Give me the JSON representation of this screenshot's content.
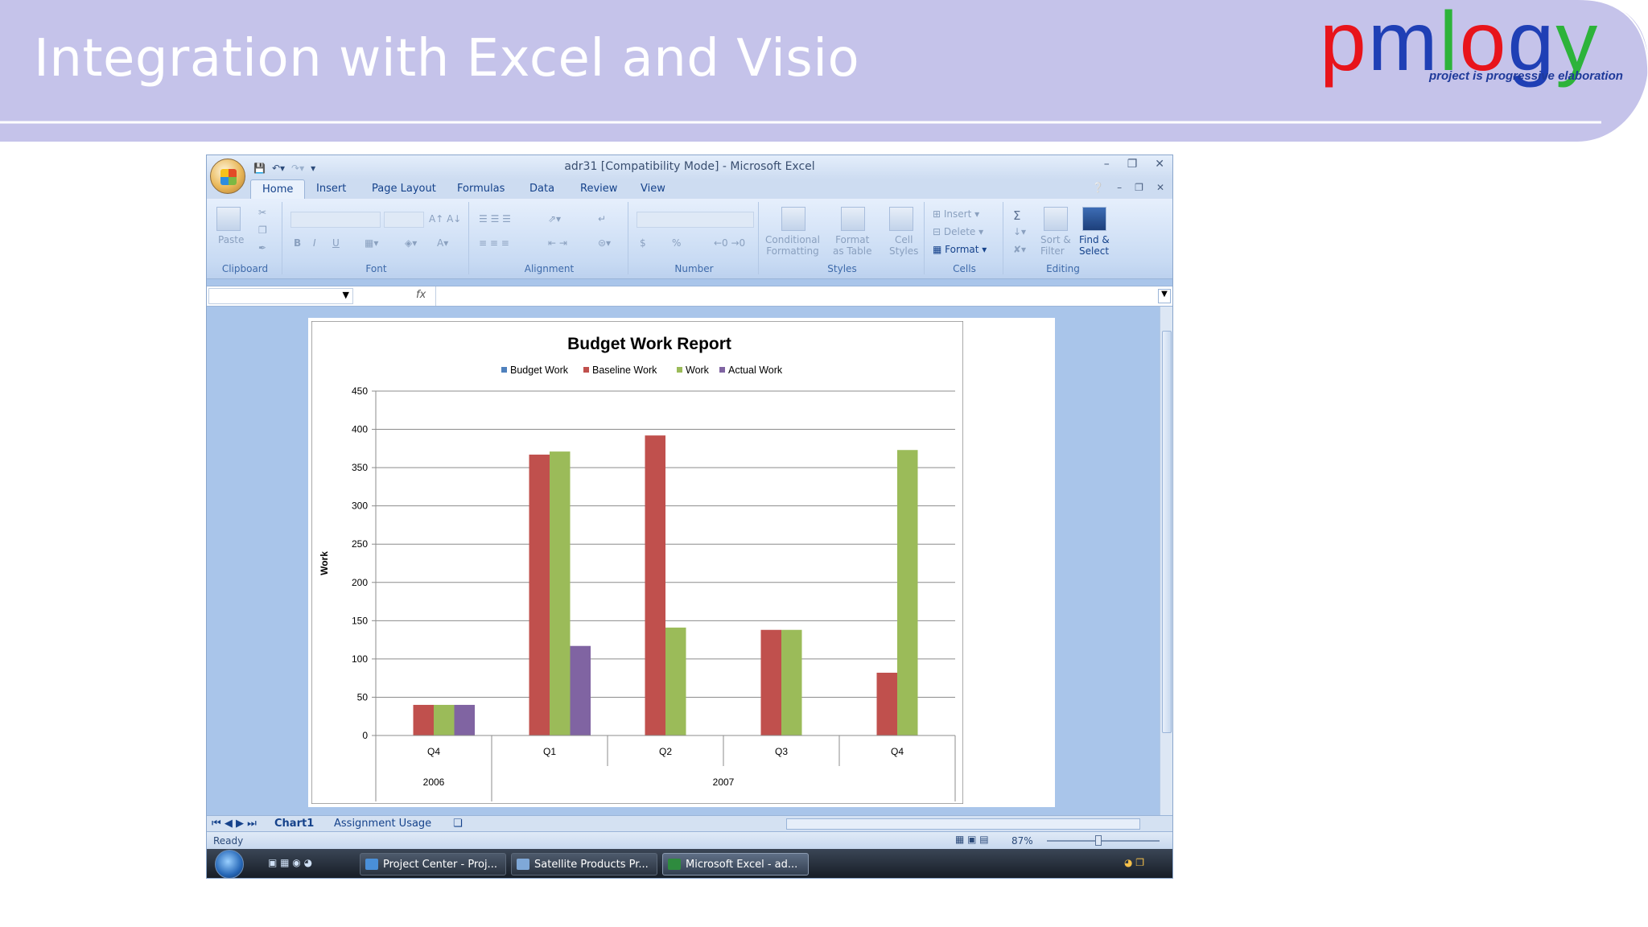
{
  "slide": {
    "title": "Integration with Excel and Visio",
    "logo": {
      "letters": [
        "p",
        "m",
        "l",
        "o",
        "g",
        "y"
      ],
      "colors": [
        "#e8141b",
        "#1f3fb5",
        "#2db33a",
        "#e8141b",
        "#1f3fb5",
        "#2db33a"
      ],
      "tagline": "project is progressive elaboration"
    }
  },
  "excel": {
    "title": "adr31  [Compatibility Mode] - Microsoft Excel",
    "tabs": [
      "Home",
      "Insert",
      "Page Layout",
      "Formulas",
      "Data",
      "Review",
      "View"
    ],
    "active_tab": "Home",
    "ribbon": {
      "clipboard": {
        "label": "Clipboard",
        "paste": "Paste"
      },
      "font": {
        "label": "Font",
        "bold": "B",
        "italic": "I",
        "underline": "U"
      },
      "alignment": {
        "label": "Alignment"
      },
      "number": {
        "label": "Number",
        "currency": "$",
        "percent": "%"
      },
      "styles": {
        "label": "Styles",
        "conditional": "Conditional\nFormatting",
        "format_table": "Format\nas Table",
        "cell_styles": "Cell\nStyles"
      },
      "cells": {
        "label": "Cells",
        "insert": "Insert",
        "delete": "Delete",
        "format": "Format"
      },
      "editing": {
        "label": "Editing",
        "sigma": "Σ",
        "sort": "Sort &\nFilter",
        "find": "Find &\nSelect"
      }
    },
    "formula_bar": {
      "fx": "fx"
    },
    "sheets": [
      "Chart1",
      "Assignment Usage"
    ],
    "active_sheet": "Chart1",
    "status": "Ready",
    "zoom": "87%"
  },
  "taskbar": {
    "items": [
      {
        "label": "Project Center - Proj...",
        "color": "#4a8fd8"
      },
      {
        "label": "Satellite Products Pr...",
        "color": "#7fa8d8"
      },
      {
        "label": "Microsoft Excel - ad...",
        "color": "#2e8b3e"
      }
    ]
  },
  "chart_data": {
    "type": "bar",
    "title": "Budget Work Report",
    "ylabel": "Work",
    "xlabel": "",
    "ylim": [
      0,
      450
    ],
    "yticks": [
      0,
      50,
      100,
      150,
      200,
      250,
      300,
      350,
      400,
      450
    ],
    "categories": [
      "Q4",
      "Q1",
      "Q2",
      "Q3",
      "Q4"
    ],
    "groups": [
      {
        "label": "2006",
        "span": 1
      },
      {
        "label": "2007",
        "span": 4
      }
    ],
    "legend_position": "top",
    "grid": true,
    "series": [
      {
        "name": "Budget Work",
        "color": "#4f81bd",
        "values": [
          0,
          0,
          0,
          0,
          0
        ]
      },
      {
        "name": "Baseline Work",
        "color": "#c0504d",
        "values": [
          40,
          367,
          392,
          138,
          82
        ]
      },
      {
        "name": "Work",
        "color": "#9bbb59",
        "values": [
          40,
          371,
          141,
          138,
          373
        ]
      },
      {
        "name": "Actual Work",
        "color": "#8064a2",
        "values": [
          40,
          117,
          0,
          0,
          0
        ]
      }
    ]
  }
}
